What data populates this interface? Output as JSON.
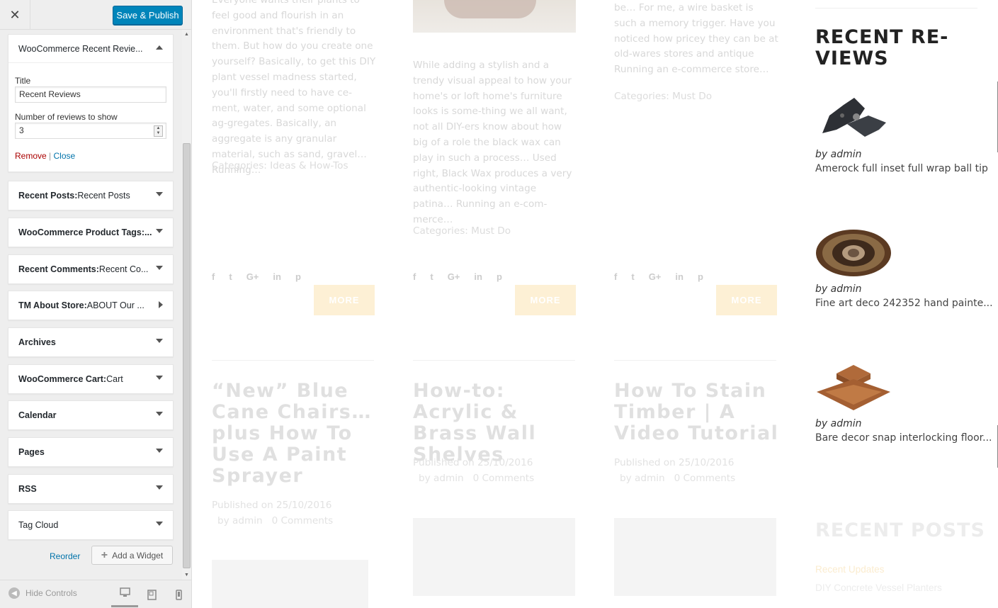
{
  "header": {
    "close_label": "✕",
    "publish_label": "Save & Publish"
  },
  "open_widget": {
    "title": "WooCommerce Recent Revie...",
    "title_label": "Title",
    "title_value": "Recent Reviews",
    "number_label": "Number of reviews to show",
    "number_value": "3",
    "remove_label": "Remove",
    "separator": "|",
    "close_label": "Close"
  },
  "widgets": [
    {
      "name": "Recent Posts:",
      "sub": " Recent Posts"
    },
    {
      "name": "WooCommerce Product Tags:...",
      "sub": ""
    },
    {
      "name": "Recent Comments:",
      "sub": " Recent Co..."
    },
    {
      "name": "TM About Store:",
      "sub": " ABOUT Our ..."
    },
    {
      "name": "Archives",
      "sub": ""
    },
    {
      "name": "WooCommerce Cart:",
      "sub": " Cart"
    },
    {
      "name": "Calendar",
      "sub": ""
    },
    {
      "name": "Pages",
      "sub": ""
    },
    {
      "name": "RSS",
      "sub": ""
    },
    {
      "name": "",
      "sub": "Tag Cloud"
    }
  ],
  "reorder_label": "Reorder",
  "add_widget_label": "Add a Widget",
  "footer": {
    "hide_controls_label": "Hide Controls"
  },
  "preview": {
    "col1_excerpt": "Everyone wants their plants to feel good and flourish in an environment that's friendly to them. But how do you create one yourself? Basically, to get this DIY plant vessel madness started, you'll firstly need to have ce-ment, water, and some optional ag-gregates. Basically, an aggregate is any granular material, such as sand, gravel… Running…",
    "col1_cats": "Categories: Ideas & How-Tos",
    "col2_excerpt": "While adding a stylish and a trendy visual appeal to how your home's or loft home's furniture looks is some-thing we all want, not all DIY-ers know about how big of a role the black wax can play in such a process… Used right, Black Wax produces a very authentic-looking vintage patina… Running an e-com-merce…",
    "col2_cats": "Categories: Must Do",
    "col3_excerpt": "be… For me, a wire basket is such a memory trigger. Have you noticed how pricey they can be at old-wares stores and antique Running an e-commerce store…",
    "col3_cats": "Categories: Must Do",
    "social_icons": [
      "f",
      "t",
      "G+",
      "in",
      "p"
    ],
    "more_label": "MORE",
    "posts": [
      {
        "title": "“New” Blue Cane Chairs…plus How To Use A Paint Sprayer",
        "published": "Published on 25/10/2016",
        "by": "by admin",
        "comments": "0 Comments"
      },
      {
        "title": "How-to: Acrylic & Brass Wall Shelves",
        "published": "Published on 25/10/2016",
        "by": "by admin",
        "comments": "0 Comments"
      },
      {
        "title": "How To Stain Timber | A Video Tutorial",
        "published": "Published on 25/10/2016",
        "by": "by admin",
        "comments": "0 Comments"
      }
    ],
    "recent_reviews_title": "RECENT RE-VIEWS",
    "reviews": [
      {
        "by": "by admin",
        "name": "Amerock full inset full wrap ball tip"
      },
      {
        "by": "by admin",
        "name": "Fine art deco 242352 hand painte..."
      },
      {
        "by": "by admin",
        "name": "Bare decor snap interlocking floor..."
      }
    ],
    "recent_posts_title": "RECENT POSTS",
    "recent_posts": [
      "Recent Updates",
      "DIY Concrete Vessel Planters"
    ]
  }
}
